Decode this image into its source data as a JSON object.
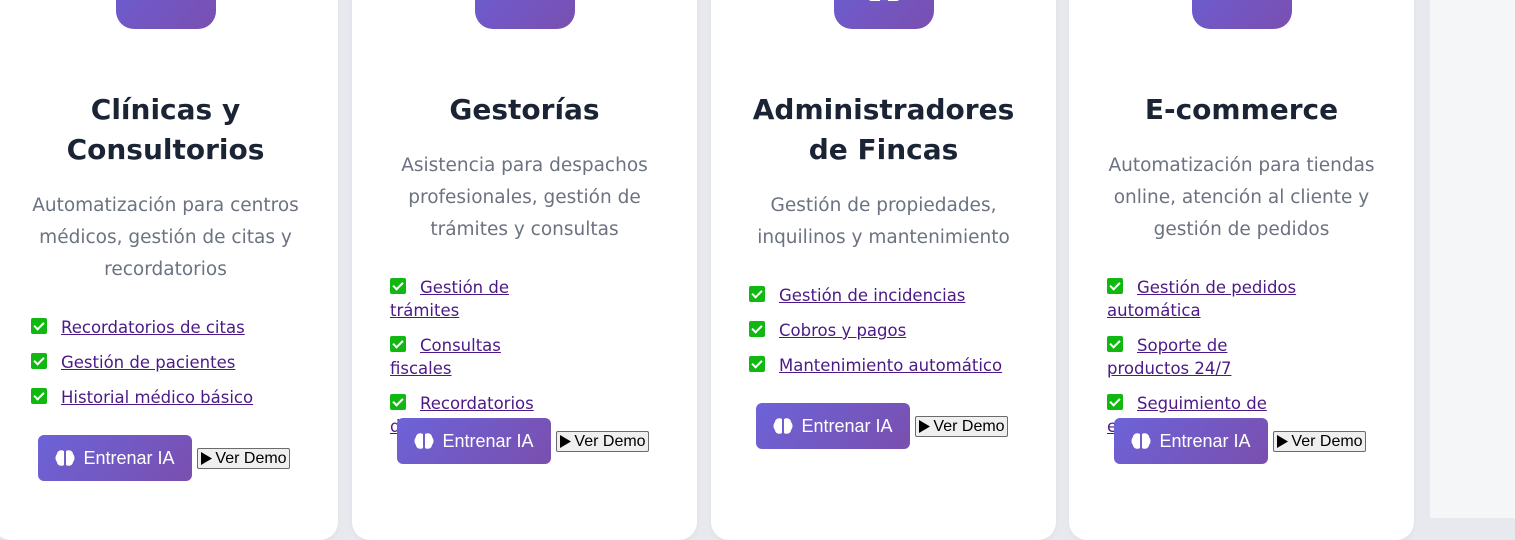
{
  "cards": [
    {
      "icon": "doctor-icon",
      "title_line1": "Clínicas y",
      "title_line2": "Consultorios",
      "desc_line1": "Automatización para centros",
      "desc_line2": "médicos, gestión de citas y",
      "desc_line3": "recordatorios",
      "features": [
        "Recordatorios de citas",
        "Gestión de pacientes",
        "Historial médico básico"
      ],
      "train_label": "Entrenar IA",
      "demo_label": "Ver Demo"
    },
    {
      "icon": "archive-box-icon",
      "title_line1": "Gestorías",
      "desc_line1": "Asistencia para despachos",
      "desc_line2": "profesionales, gestión de",
      "desc_line3": "trámites y consultas",
      "features": [
        "Gestión de trámites",
        "Consultas fiscales",
        "Recordatorios de vencimientos"
      ],
      "train_label": "Entrenar IA",
      "demo_label": "Ver Demo"
    },
    {
      "icon": "building-icon",
      "title_line1": "Administradores",
      "title_line2": "de Fincas",
      "desc_line1": "Gestión de propiedades,",
      "desc_line2": "inquilinos y mantenimiento",
      "features": [
        "Gestión de incidencias",
        "Cobros y pagos",
        "Mantenimiento automático"
      ],
      "train_label": "Entrenar IA",
      "demo_label": "Ver Demo"
    },
    {
      "icon": "shopping-cart-icon",
      "title_line1": "E-commerce",
      "desc_line1": "Automatización para tiendas",
      "desc_line2": "online, atención al cliente y",
      "desc_line3": "gestión de pedidos",
      "features": [
        "Gestión de pedidos automática",
        "Soporte de productos 24/7",
        "Seguimiento de envíos"
      ],
      "train_label": "Entrenar IA",
      "demo_label": "Ver Demo"
    }
  ],
  "colors": {
    "accent_start": "#6a5fd6",
    "accent_end": "#7a4fb0",
    "check_green": "#12b812",
    "link_purple": "#4b1a86",
    "title_dark": "#1b2435",
    "desc_gray": "#6b7280"
  }
}
